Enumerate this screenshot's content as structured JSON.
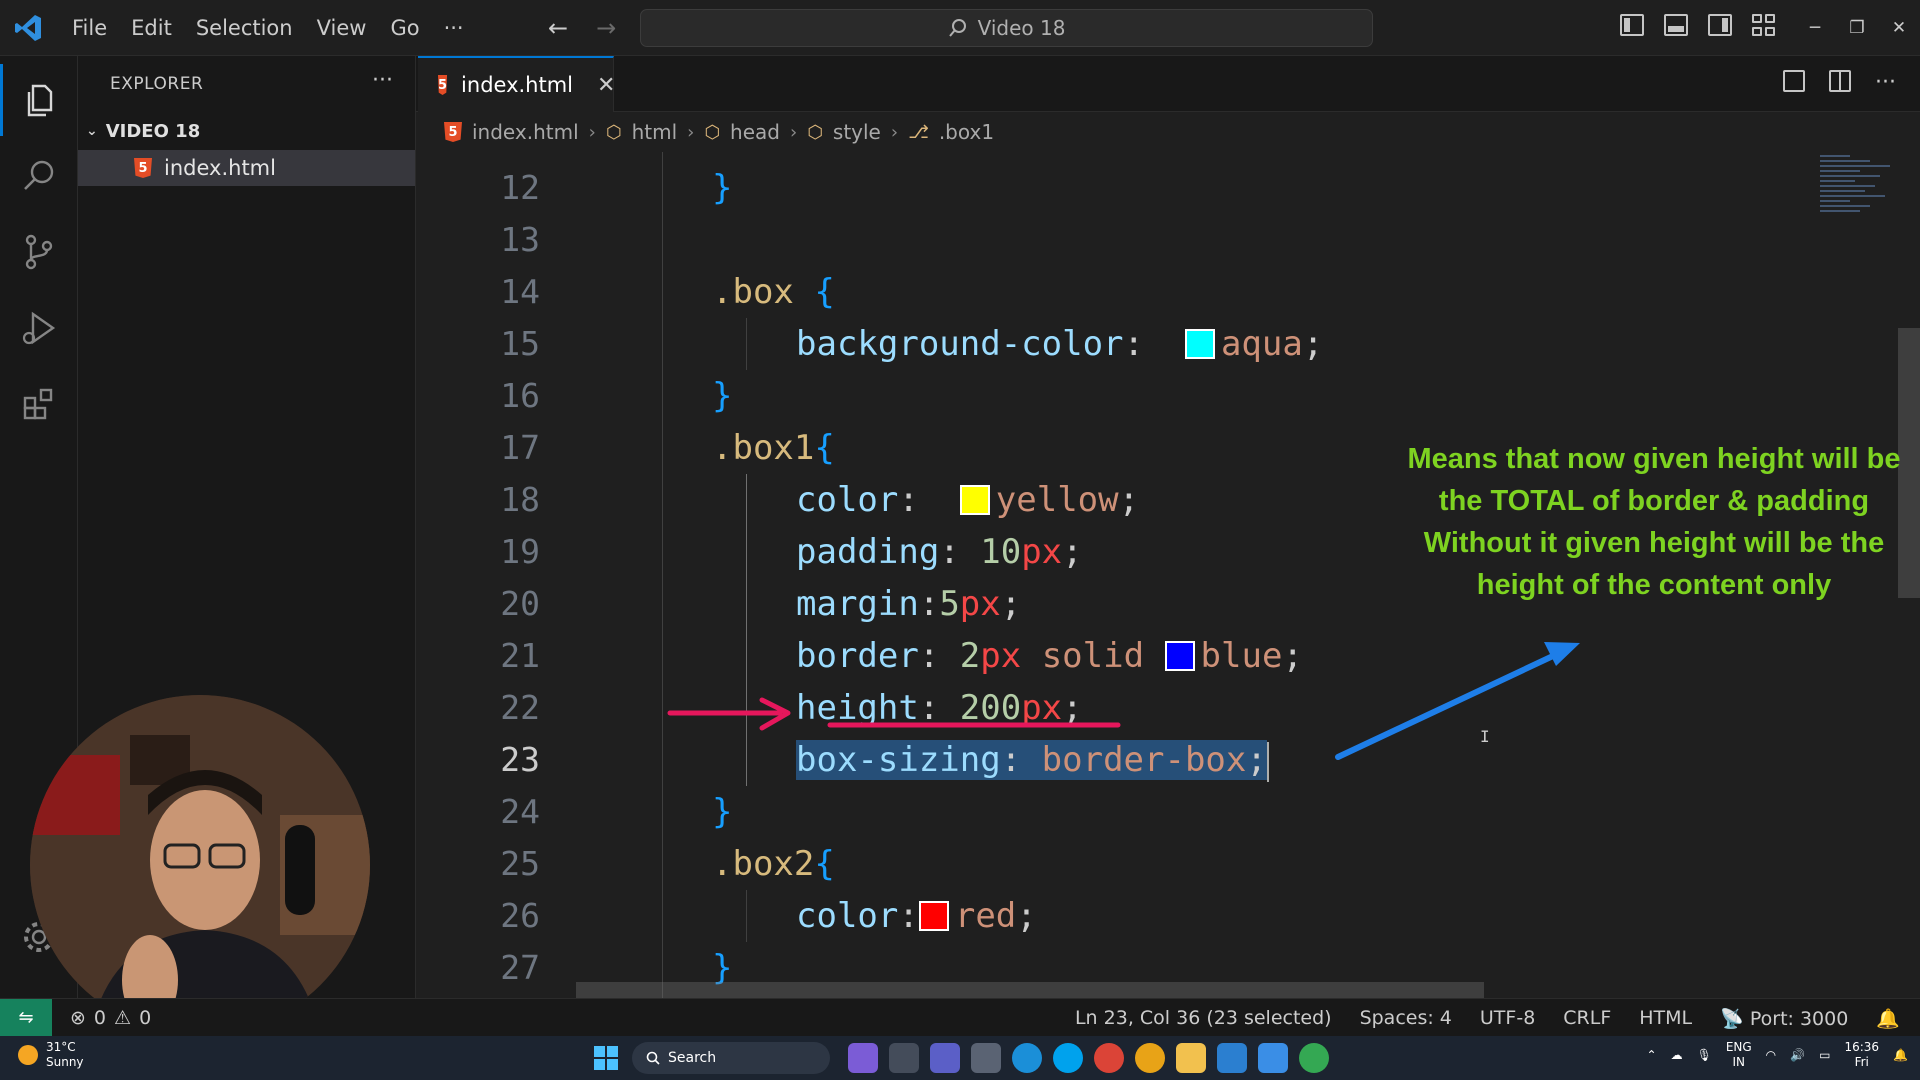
{
  "titlebar": {
    "menu": [
      "File",
      "Edit",
      "Selection",
      "View",
      "Go",
      "···"
    ],
    "search_text": "Video 18"
  },
  "sidebar": {
    "title": "EXPLORER",
    "more": "···",
    "folder_name": "VIDEO 18",
    "file_name": "index.html"
  },
  "editor": {
    "tab_label": "index.html",
    "tab_close": "✕",
    "breadcrumbs": [
      "index.html",
      "html",
      "head",
      "style",
      ".box1"
    ],
    "lines": [
      {
        "num": "12"
      },
      {
        "num": "13"
      },
      {
        "num": "14"
      },
      {
        "num": "15"
      },
      {
        "num": "16"
      },
      {
        "num": "17"
      },
      {
        "num": "18"
      },
      {
        "num": "19"
      },
      {
        "num": "20"
      },
      {
        "num": "21"
      },
      {
        "num": "22"
      },
      {
        "num": "23"
      },
      {
        "num": "24"
      },
      {
        "num": "25"
      },
      {
        "num": "26"
      },
      {
        "num": "27"
      }
    ],
    "code": {
      "l12_brace": "}",
      "l14_selector": ".box",
      "l14_brace": "{",
      "l15_prop": "background-color",
      "l15_value": "aqua",
      "l16_brace": "}",
      "l17_selector": ".box1",
      "l17_brace": "{",
      "l18_prop": "color",
      "l18_value": "yellow",
      "l19_prop": "padding",
      "l19_num": "10",
      "l19_unit": "px",
      "l20_prop": "margin",
      "l20_num": "5",
      "l20_unit": "px",
      "l21_prop": "border",
      "l21_num": "2",
      "l21_unit": "px",
      "l21_style": "solid",
      "l21_color": "blue",
      "l22_prop": "height",
      "l22_num": "200",
      "l22_unit": "px",
      "l23_prop": "box-sizing",
      "l23_value": "border-box",
      "l24_brace": "}",
      "l25_selector": ".box2",
      "l25_brace": "{",
      "l26_prop": "color",
      "l26_value": "red",
      "l27_brace": "}"
    },
    "swatches": {
      "aqua": "#00ffff",
      "yellow": "#ffff00",
      "blue": "#0000ff",
      "red": "#ff0000"
    }
  },
  "annotation": {
    "lines": [
      "Means that now given height will be",
      "the TOTAL of border & padding",
      "Without it given height will be the",
      "height of the content only"
    ],
    "color": "#7ed321"
  },
  "statusbar": {
    "errors": "0",
    "warnings": "0",
    "position": "Ln 23, Col 36 (23 selected)",
    "spaces": "Spaces: 4",
    "encoding": "UTF-8",
    "eol": "CRLF",
    "language": "HTML",
    "port": "Port: 3000"
  },
  "taskbar": {
    "temperature": "31°C",
    "weather": "Sunny",
    "search": "Search",
    "lang_top": "ENG",
    "lang_bottom": "IN",
    "time": "16:36",
    "day": "Fri"
  },
  "colors": {
    "accent": "#0078d4",
    "remote": "#16825d",
    "selection": "#264f78",
    "arrow_red": "#e6175c",
    "arrow_blue": "#1e7ee8"
  }
}
